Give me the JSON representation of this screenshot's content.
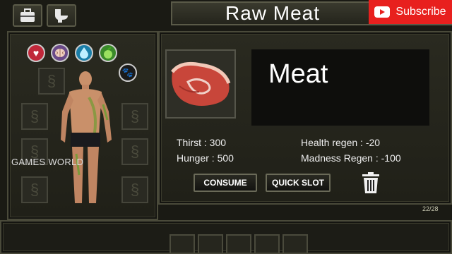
{
  "header": {
    "title": "Raw Meat",
    "subscribe_label": "Subscribe"
  },
  "top_buttons": [
    {
      "icon": "briefcase-icon"
    },
    {
      "icon": "toilet-icon"
    }
  ],
  "character": {
    "stats_icons": [
      "heart-icon",
      "brain-icon",
      "water-drop-icon",
      "apple-icon"
    ],
    "pet_icon": "paw-icon",
    "watermark": "GAMES WORLD"
  },
  "item": {
    "name": "Meat",
    "icon": "raw-steak-icon",
    "stats": {
      "thirst": "Thirst : 300",
      "hunger": "Hunger : 500",
      "health_regen": "Health regen : -20",
      "madness_regen": "Madness Regen : -100"
    },
    "actions": {
      "consume": "CONSUME",
      "quick_slot": "QUICK SLOT"
    }
  },
  "inventory_counter": "22/28",
  "colors": {
    "health": "#c0283a",
    "brain": "#8a6aa0",
    "water": "#2aa0c8",
    "food": "#5aa83a",
    "youtube": "#e8201e",
    "meat": "#c8463a"
  }
}
